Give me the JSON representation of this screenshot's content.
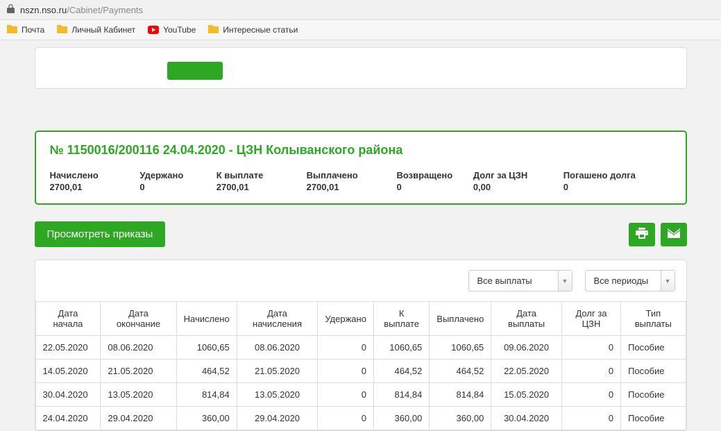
{
  "address": {
    "host": "nszn.nso.ru",
    "path": "/Cabinet/Payments"
  },
  "bookmarks": [
    {
      "label": "Почта",
      "icon": "folder"
    },
    {
      "label": "Личный Кабинет",
      "icon": "folder"
    },
    {
      "label": "YouTube",
      "icon": "youtube"
    },
    {
      "label": "Интересные статьи",
      "icon": "folder"
    }
  ],
  "summary": {
    "title": "№ 1150016/200116 24.04.2020 - ЦЗН Колыванского района",
    "items": [
      {
        "label": "Начислено",
        "value": "2700,01"
      },
      {
        "label": "Удержано",
        "value": "0"
      },
      {
        "label": "К выплате",
        "value": "2700,01"
      },
      {
        "label": "Выплачено",
        "value": "2700,01"
      },
      {
        "label": "Возвращено",
        "value": "0"
      },
      {
        "label": "Долг за ЦЗН",
        "value": "0,00"
      },
      {
        "label": "Погашено долга",
        "value": "0"
      }
    ]
  },
  "actions": {
    "view_orders": "Просмотреть приказы"
  },
  "filters": {
    "payments": "Все выплаты",
    "periods": "Все периоды"
  },
  "table": {
    "headers": [
      "Дата начала",
      "Дата окончание",
      "Начислено",
      "Дата начисления",
      "Удержано",
      "К выплате",
      "Выплачено",
      "Дата выплаты",
      "Долг за ЦЗН",
      "Тип выплаты"
    ],
    "rows": [
      [
        "22.05.2020",
        "08.06.2020",
        "1060,65",
        "08.06.2020",
        "0",
        "1060,65",
        "1060,65",
        "09.06.2020",
        "0",
        "Пособие"
      ],
      [
        "14.05.2020",
        "21.05.2020",
        "464,52",
        "21.05.2020",
        "0",
        "464,52",
        "464,52",
        "22.05.2020",
        "0",
        "Пособие"
      ],
      [
        "30.04.2020",
        "13.05.2020",
        "814,84",
        "13.05.2020",
        "0",
        "814,84",
        "814,84",
        "15.05.2020",
        "0",
        "Пособие"
      ],
      [
        "24.04.2020",
        "29.04.2020",
        "360,00",
        "29.04.2020",
        "0",
        "360,00",
        "360,00",
        "30.04.2020",
        "0",
        "Пособие"
      ]
    ]
  }
}
